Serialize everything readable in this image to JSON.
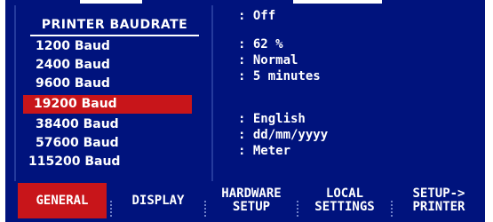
{
  "right_values": {
    "v1": ": Off",
    "v2": ": 62 %",
    "v3": ": Normal",
    "v4": ": 5 minutes",
    "v5": ": English",
    "v6": ": dd/mm/yyyy",
    "v7": ": Meter"
  },
  "dropdown": {
    "title": "PRINTER BAUDRATE",
    "options": [
      "1200 Baud",
      "2400 Baud",
      "9600 Baud",
      "19200 Baud",
      "38400 Baud",
      "57600 Baud",
      "115200 Baud"
    ],
    "selected": "19200 Baud"
  },
  "softkeys": {
    "general": "GENERAL",
    "display": "DISPLAY",
    "hardware_line1": "HARDWARE",
    "hardware_line2": "SETUP",
    "local_line1": "LOCAL",
    "local_line2": "SETTINGS",
    "setup_line1": "SETUP->",
    "setup_line2": "PRINTER"
  },
  "colors": {
    "background": "#00137d",
    "highlight": "#c8151a",
    "text": "#ffffff"
  }
}
